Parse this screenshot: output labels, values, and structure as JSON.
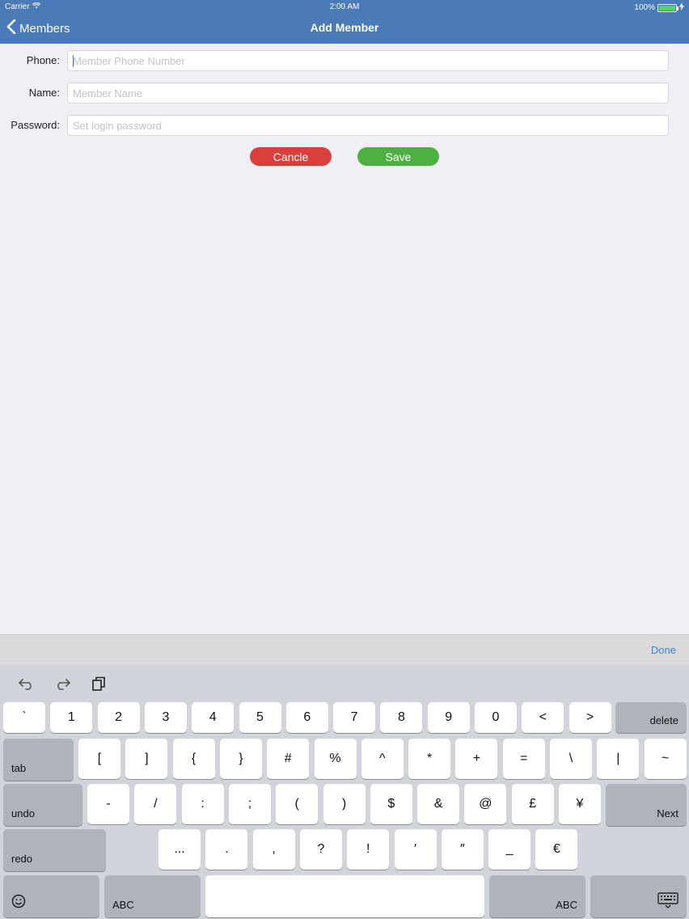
{
  "status_bar": {
    "carrier": "Carrier",
    "time": "2:00 AM",
    "battery": "100%"
  },
  "nav": {
    "back_label": "Members",
    "title": "Add Member"
  },
  "form": {
    "phone": {
      "label": "Phone:",
      "placeholder": "Member Phone Number",
      "value": ""
    },
    "name": {
      "label": "Name:",
      "placeholder": "Member Name",
      "value": ""
    },
    "password": {
      "label": "Password:",
      "placeholder": "Set login password",
      "value": ""
    }
  },
  "buttons": {
    "cancel": "Cancle",
    "save": "Save"
  },
  "keyboard": {
    "accessory_done": "Done",
    "shortcut_icons": [
      "undo-icon",
      "redo-icon",
      "paste-icon"
    ],
    "row1": [
      "`",
      "1",
      "2",
      "3",
      "4",
      "5",
      "6",
      "7",
      "8",
      "9",
      "0",
      "<",
      ">"
    ],
    "row1_delete": "delete",
    "row2_tab": "tab",
    "row2": [
      "[",
      "]",
      "{",
      "}",
      "#",
      "%",
      "^",
      "*",
      "+",
      "=",
      "\\",
      "|",
      "~"
    ],
    "row3_undo": "undo",
    "row3": [
      "-",
      "/",
      ":",
      ";",
      "(",
      ")",
      "$",
      "&",
      "@",
      "£",
      "¥"
    ],
    "row3_next": "Next",
    "row4_redo": "redo",
    "row4": [
      "...",
      ".",
      ",",
      "?",
      "!",
      "′",
      "″",
      "_",
      "€"
    ],
    "row5_abc_left": "ABC",
    "row5_abc_right": "ABC",
    "row5_icons": [
      "emoji-icon",
      "keyboard-dismiss-icon"
    ]
  },
  "colors": {
    "nav_bg": "#4a7ab7",
    "cancel": "#d9403c",
    "save": "#4db142",
    "done": "#3a82d6"
  }
}
